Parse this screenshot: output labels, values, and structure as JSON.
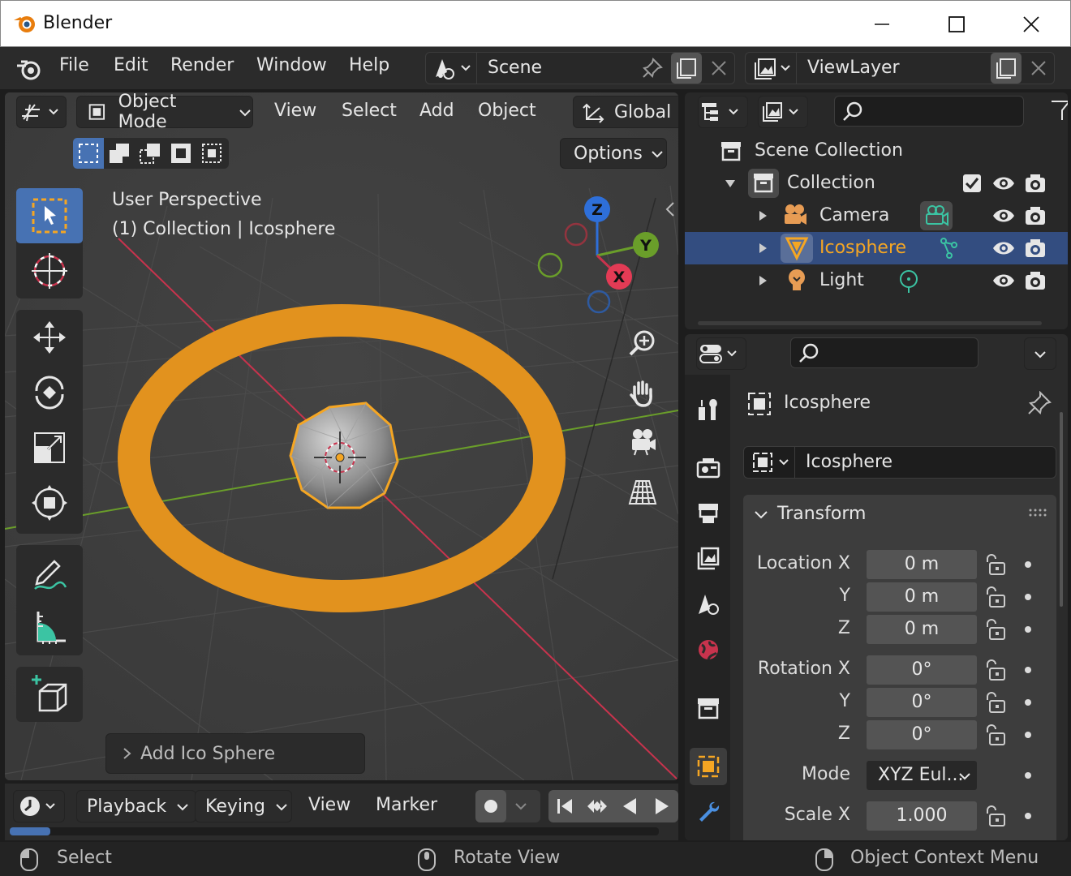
{
  "window": {
    "title": "Blender"
  },
  "menubar": {
    "items": [
      "File",
      "Edit",
      "Render",
      "Window",
      "Help"
    ],
    "scene_label": "Scene",
    "viewlayer_label": "ViewLayer"
  },
  "viewport": {
    "mode_label": "Object Mode",
    "menus": [
      "View",
      "Select",
      "Add",
      "Object"
    ],
    "transform_orientation": "Global",
    "options_label": "Options",
    "info_line1": "User Perspective",
    "info_line2": "(1) Collection | Icosphere",
    "gizmo_axes": {
      "x": "X",
      "y": "Y",
      "z": "Z"
    },
    "last_operator": "Add Ico Sphere",
    "colors": {
      "selection": "#f5a623",
      "torus": "#e2921e",
      "x_axis": "#c8334d",
      "y_axis": "#6a9e2a"
    }
  },
  "timeline": {
    "menus": [
      "Playback",
      "Keying",
      "View",
      "Marker"
    ]
  },
  "statusbar": {
    "left": "Select",
    "middle": "Rotate View",
    "right": "Object Context Menu"
  },
  "outliner": {
    "scene_collection": "Scene Collection",
    "collection": "Collection",
    "items": [
      {
        "label": "Camera",
        "selected": false
      },
      {
        "label": "Icosphere",
        "selected": true
      },
      {
        "label": "Light",
        "selected": false
      }
    ]
  },
  "properties": {
    "object_name_header": "Icosphere",
    "object_name_field": "Icosphere",
    "panel_title": "Transform",
    "location": {
      "label": "Location X",
      "x": "0 m",
      "y": "0 m",
      "z": "0 m"
    },
    "rotation": {
      "label": "Rotation X",
      "x": "0°",
      "y": "0°",
      "z": "0°"
    },
    "axis_y": "Y",
    "axis_z": "Z",
    "mode": {
      "label": "Mode",
      "value": "XYZ Eul..."
    },
    "scale": {
      "label": "Scale X",
      "x": "1.000"
    }
  }
}
